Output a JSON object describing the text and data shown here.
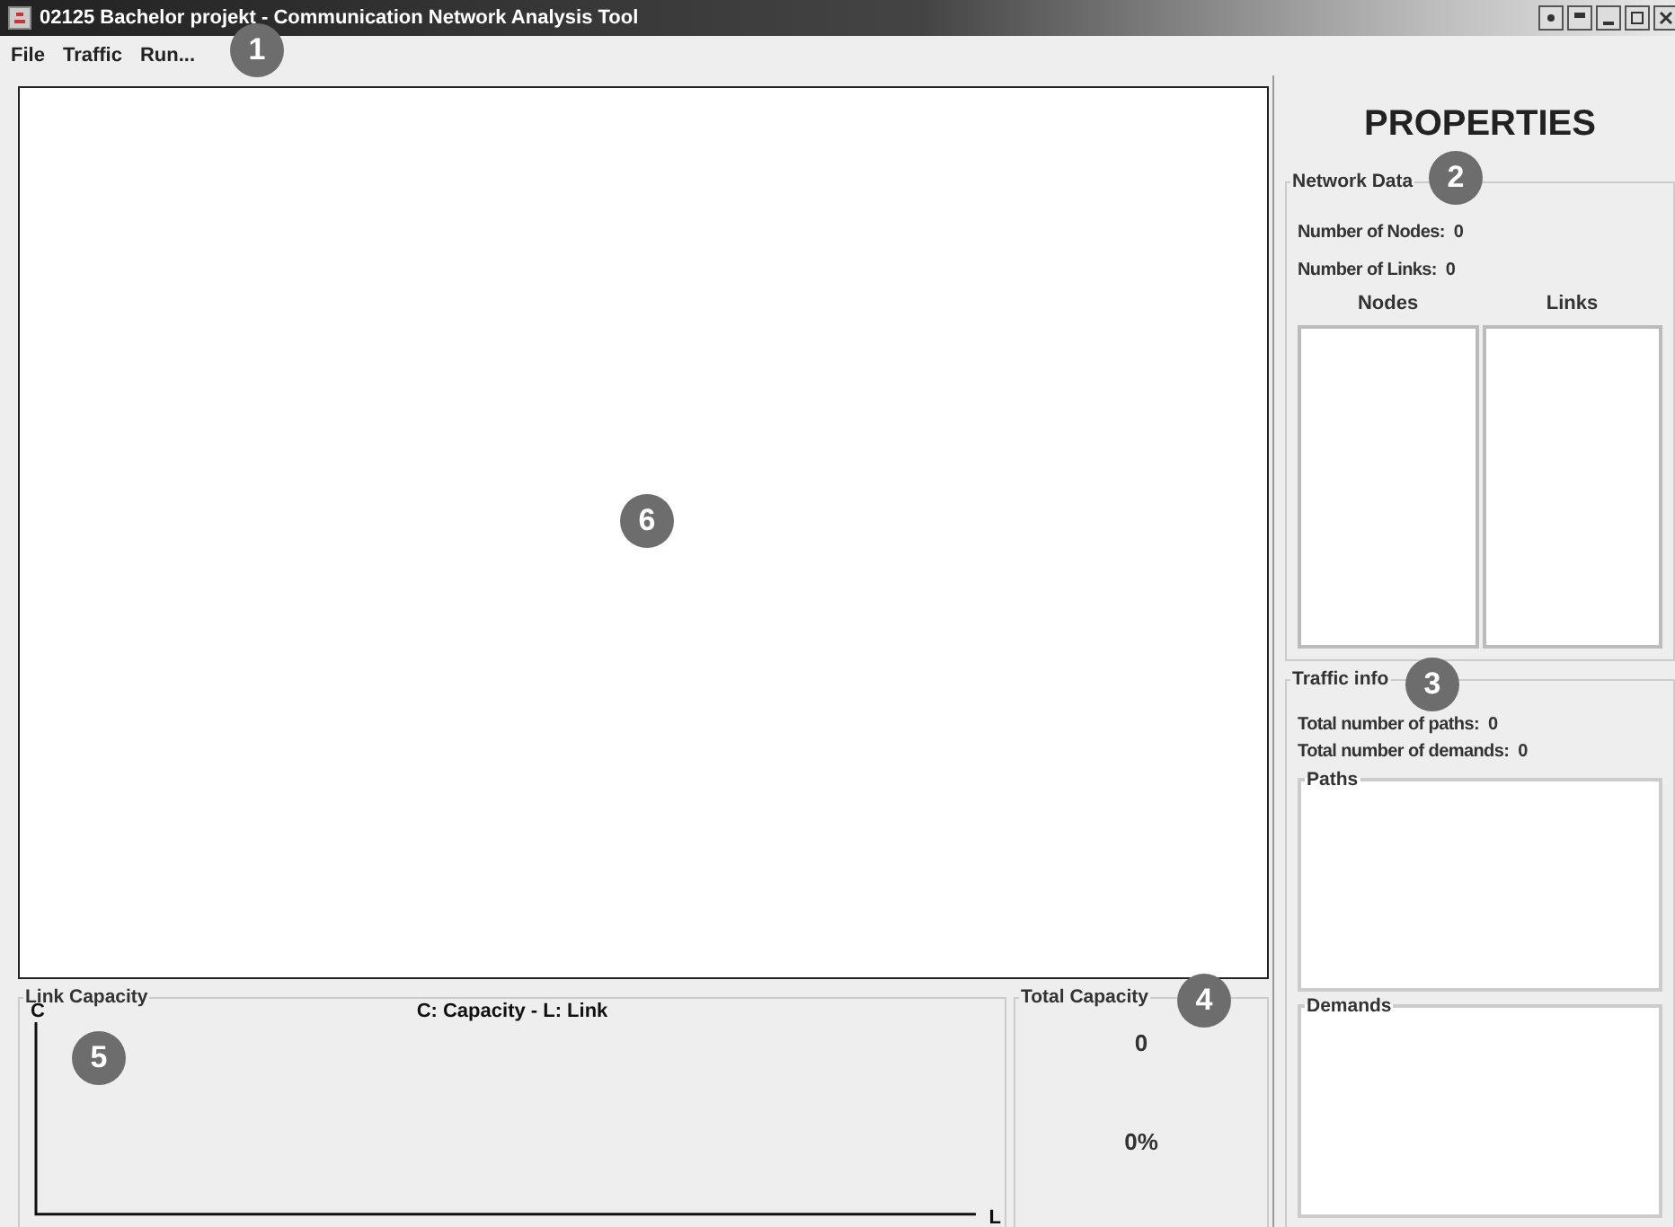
{
  "window": {
    "title": "02125 Bachelor projekt - Communication Network Analysis Tool"
  },
  "menu": [
    {
      "label": "File"
    },
    {
      "label": "Traffic"
    },
    {
      "label": "Run..."
    }
  ],
  "properties": {
    "heading": "PROPERTIES",
    "network_data": {
      "legend": "Network Data",
      "stats": [
        {
          "label": "Number of Nodes:",
          "value": "0"
        },
        {
          "label": "Number of Links:",
          "value": "0"
        }
      ],
      "lists": [
        {
          "heading": "Nodes"
        },
        {
          "heading": "Links"
        }
      ]
    },
    "traffic_info": {
      "legend": "Traffic info",
      "stats": [
        {
          "label": "Total number of paths:",
          "value": "0"
        },
        {
          "label": "Total number of demands:",
          "value": "0"
        }
      ],
      "boxes": [
        {
          "legend": "Paths"
        },
        {
          "legend": "Demands"
        }
      ]
    }
  },
  "link_capacity": {
    "legend": "Link Capacity",
    "caption": "C: Capacity - L: Link",
    "y_axis": "C",
    "x_axis": "L"
  },
  "total_capacity": {
    "legend": "Total Capacity",
    "value": "0",
    "percent": "0%"
  },
  "callouts": [
    {
      "label": "1"
    },
    {
      "label": "2"
    },
    {
      "label": "3"
    },
    {
      "label": "4"
    },
    {
      "label": "5"
    },
    {
      "label": "6"
    }
  ]
}
